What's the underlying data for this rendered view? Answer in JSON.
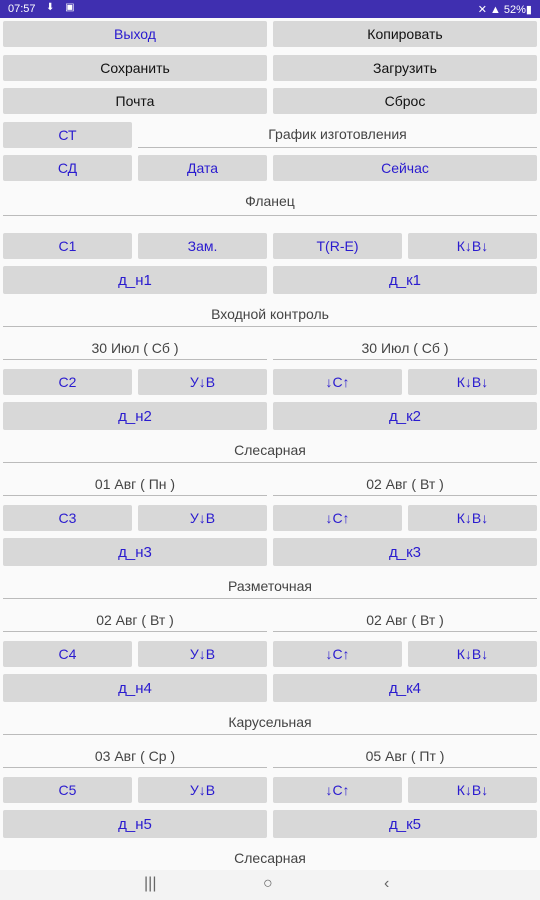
{
  "status": {
    "time": "07:57",
    "left_icons": "⬇ ▣",
    "right": "✕ ▲ 52%▮"
  },
  "top": {
    "exit": "Выход",
    "copy": "Копировать",
    "save": "Сохранить",
    "load": "Загрузить",
    "mail": "Почта",
    "reset": "Сброс"
  },
  "schedule": {
    "st": "СТ",
    "title": "График изготовления",
    "sd": "СД",
    "date": "Дата",
    "now": "Сейчас"
  },
  "product": {
    "name": "Фланец"
  },
  "stages": [
    {
      "c": "С1",
      "second": "Зам.",
      "third": "Т(R-E)",
      "fourth": "К↓В↓",
      "dn": "д_н1",
      "dk": "д_к1",
      "title": "Входной контроль",
      "date_start": "30 Июл ( Сб )",
      "date_end": "30 Июл ( Сб )"
    },
    {
      "c": "С2",
      "second": "У↓В",
      "third": "↓С↑",
      "fourth": "К↓В↓",
      "dn": "д_н2",
      "dk": "д_к2",
      "title": "Слесарная",
      "date_start": "01 Авг ( Пн )",
      "date_end": "02 Авг ( Вт )"
    },
    {
      "c": "С3",
      "second": "У↓В",
      "third": "↓С↑",
      "fourth": "К↓В↓",
      "dn": "д_н3",
      "dk": "д_к3",
      "title": "Разметочная",
      "date_start": "02 Авг ( Вт )",
      "date_end": "02 Авг ( Вт )"
    },
    {
      "c": "С4",
      "second": "У↓В",
      "third": "↓С↑",
      "fourth": "К↓В↓",
      "dn": "д_н4",
      "dk": "д_к4",
      "title": "Карусельная",
      "date_start": "03 Авг ( Ср )",
      "date_end": "05 Авг ( Пт )"
    },
    {
      "c": "С5",
      "second": "У↓В",
      "third": "↓С↑",
      "fourth": "К↓В↓",
      "dn": "д_н5",
      "dk": "д_к5",
      "title": "Слесарная"
    }
  ],
  "nav": {
    "recents": "|||",
    "home": "○",
    "back": "‹"
  }
}
